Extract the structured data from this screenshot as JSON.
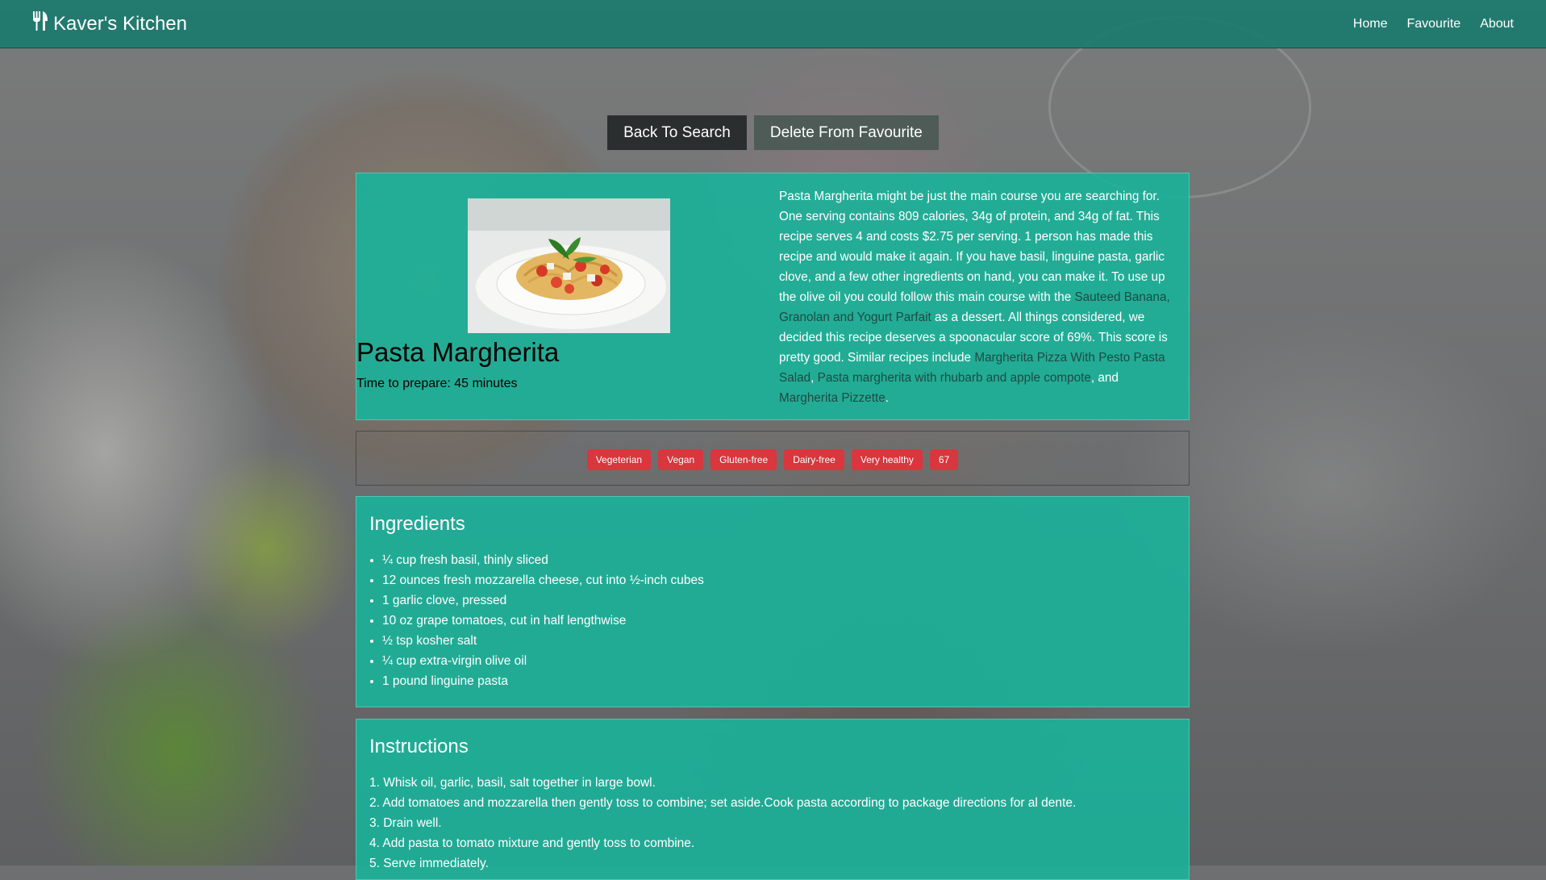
{
  "nav": {
    "brand": "Kaver's Kitchen",
    "links": [
      "Home",
      "Favourite",
      "About"
    ]
  },
  "actions": {
    "back": "Back To Search",
    "delete": "Delete From Favourite"
  },
  "recipe": {
    "title": "Pasta Margherita",
    "prep_time": "Time to prepare: 45 minutes",
    "summary": {
      "p1": "Pasta Margherita might be just the main course you are searching for. One serving contains 809 calories, 34g of protein, and 34g of fat. This recipe serves 4 and costs $2.75 per serving. 1 person has made this recipe and would make it again. If you have basil, linguine pasta, garlic clove, and a few other ingredients on hand, you can make it. To use up the olive oil you could follow this main course with the ",
      "link1": "Sauteed Banana, Granolan and Yogurt Parfait",
      "p2": " as a dessert. All things considered, we decided this recipe deserves a spoonacular score of 69%. This score is pretty good. Similar recipes include ",
      "link2": "Margherita Pizza With Pesto Pasta Salad",
      "sep1": ", ",
      "link3": "Pasta margherita with rhubarb and apple compote",
      "sep2": ", and ",
      "link4": "Margherita Pizzette",
      "end": "."
    }
  },
  "badges": [
    "Vegeterian",
    "Vegan",
    "Gluten-free",
    "Dairy-free",
    "Very healthy",
    "67"
  ],
  "ingredients": {
    "heading": "Ingredients",
    "items": [
      "¼ cup fresh basil, thinly sliced",
      "12 ounces fresh mozzarella cheese, cut into ½-inch cubes",
      "1 garlic clove, pressed",
      "10 oz grape tomatoes, cut in half lengthwise",
      "½ tsp kosher salt",
      "¼ cup extra-virgin olive oil",
      "1 pound linguine pasta"
    ]
  },
  "instructions": {
    "heading": "Instructions",
    "steps": [
      "1. Whisk oil, garlic, basil, salt together in large bowl.",
      "2. Add tomatoes and mozzarella then gently toss to combine; set aside.Cook pasta according to package directions for al dente.",
      "3. Drain well.",
      "4. Add pasta to tomato mixture and gently toss to combine.",
      "5. Serve immediately."
    ]
  },
  "colors": {
    "navbar": "#1b7a6e",
    "card": "#1ab29a",
    "badge": "#d9363e",
    "button": "#2b2e2f"
  }
}
